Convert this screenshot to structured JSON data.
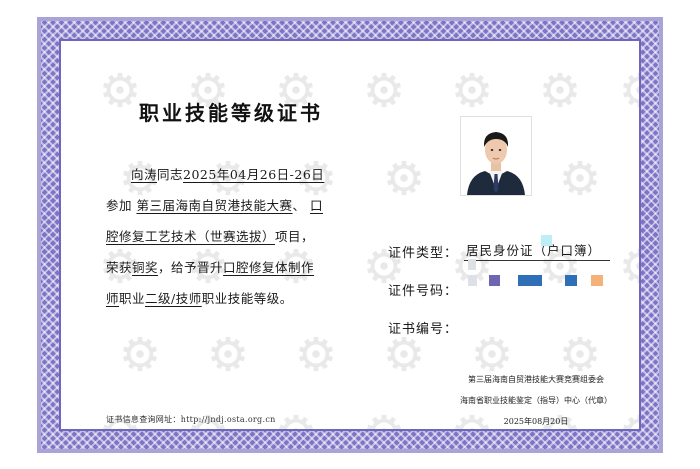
{
  "certificate": {
    "title": "职业技能等级证书",
    "body": {
      "name": "向涛",
      "salutation": "同志",
      "date_range": "2025年04月26日-26日",
      "prefix": "参加",
      "competition": "第三届海南自贸港技能大赛",
      "comma": "、",
      "event": "口腔修复工艺技术（世赛选拔）",
      "suffix_1": "项目，荣获",
      "award": "铜奖",
      "suffix_2": "，给予晋升",
      "occupation": "口腔修复体制作师",
      "suffix_3": "职业",
      "level": "二级/技师",
      "suffix_4": "职业技能等级。"
    },
    "query_text": "证书信息查询网址：http://jndj.osta.org.cn",
    "fields": {
      "id_type_label": "证件类型：",
      "id_type_value": "居民身份证（户口簿）",
      "id_number_label": "证件号码：",
      "cert_number_label": "证书编号："
    },
    "issuer": {
      "line1": "第三届海南自贸港技能大赛竞赛组委会",
      "line2": "海南省职业技能鉴定（指导）中心（代章）",
      "date": "2025年08月20日"
    },
    "colors": {
      "frame": "#7d74c6",
      "frame_light": "#a9a3d8",
      "redact_cyan": "#bdeef8",
      "redact_gray": "#dde0e4",
      "redact_purple": "#6f66b3",
      "redact_blue": "#2f6fb8",
      "redact_orange": "#f4b27a"
    },
    "watermark": {
      "icon": "gear-skills-icon",
      "text": "skills"
    }
  }
}
